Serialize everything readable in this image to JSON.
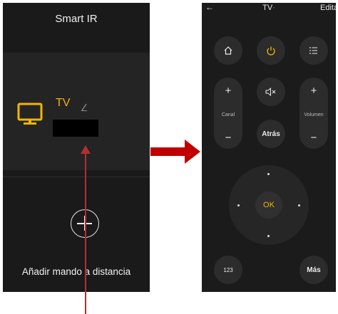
{
  "left_screen": {
    "title": "Smart IR",
    "device": {
      "name": "TV",
      "icon": "tv-icon",
      "edit_icon": "pencil-icon",
      "accent_color": "#f4b400"
    },
    "add_button": {
      "icon": "plus-icon",
      "label": "Añadir mando a distancia"
    }
  },
  "right_screen": {
    "header": {
      "back_icon_glyph": "←",
      "title": "TV",
      "title_suffix": "·",
      "edit_label": "Editar"
    },
    "buttons": {
      "home": "⌂",
      "power": "⏻",
      "menu": "☰",
      "mute": "🔇",
      "channel_label": "Canal",
      "volume_label": "Volumen",
      "plus": "+",
      "minus": "−",
      "back_label": "Atrás",
      "ok_label": "OK",
      "numpad_label": "123",
      "more_label": "Más"
    },
    "colors": {
      "background": "#1b1b1b",
      "button": "#2c2c2c",
      "power_accent": "#f4b400"
    }
  }
}
